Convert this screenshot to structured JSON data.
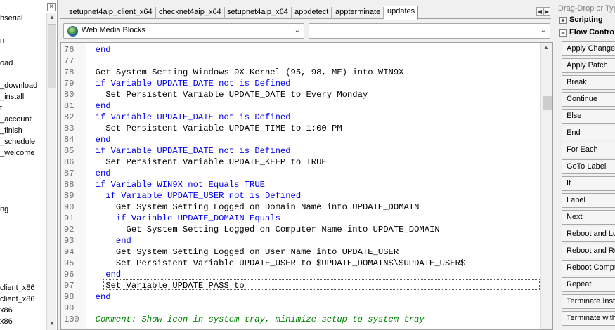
{
  "left_tree": {
    "items": [
      "hserial",
      "n",
      "oad",
      "_download",
      "_install",
      "t",
      "_account",
      "_finish",
      "_schedule",
      "_welcome",
      "ng",
      "client_x86",
      "client_x86",
      "x86",
      "x86"
    ]
  },
  "tabs": [
    "setupnet4aip_client_x64",
    "checknet4aip_x64",
    "setupnet4aip_x64",
    "appdetect",
    "appterminate",
    "updates"
  ],
  "active_tab": "updates",
  "dropdowns": {
    "left_value": "Web Media Blocks",
    "right_value": ""
  },
  "editor": {
    "lines": [
      {
        "num": "76",
        "text": "  end",
        "style": "blue"
      },
      {
        "num": "77",
        "text": "",
        "style": "plain"
      },
      {
        "num": "78",
        "text": "  Get System Setting Windows 9X Kernel (95, 98, ME) into WIN9X",
        "style": "plain"
      },
      {
        "num": "79",
        "text": "  if Variable UPDATE_DATE not is Defined",
        "style": "blue"
      },
      {
        "num": "80",
        "text": "    Set Persistent Variable UPDATE_DATE to Every Monday",
        "style": "plain"
      },
      {
        "num": "81",
        "text": "  end",
        "style": "blue"
      },
      {
        "num": "82",
        "text": "  if Variable UPDATE_DATE not is Defined",
        "style": "blue"
      },
      {
        "num": "83",
        "text": "    Set Persistent Variable UPDATE_TIME to 1:00 PM",
        "style": "plain"
      },
      {
        "num": "84",
        "text": "  end",
        "style": "blue"
      },
      {
        "num": "85",
        "text": "  if Variable UPDATE_DATE not is Defined",
        "style": "blue"
      },
      {
        "num": "86",
        "text": "    Set Persistent Variable UPDATE_KEEP to TRUE",
        "style": "plain"
      },
      {
        "num": "87",
        "text": "  end",
        "style": "blue"
      },
      {
        "num": "88",
        "text": "  if Variable WIN9X not Equals TRUE",
        "style": "blue"
      },
      {
        "num": "89",
        "text": "    if Variable UPDATE_USER not is Defined",
        "style": "blue"
      },
      {
        "num": "90",
        "text": "      Get System Setting Logged on Domain Name into UPDATE_DOMAIN",
        "style": "plain"
      },
      {
        "num": "91",
        "text": "      if Variable UPDATE_DOMAIN Equals",
        "style": "blue"
      },
      {
        "num": "92",
        "text": "        Get System Setting Logged on Computer Name into UPDATE_DOMAIN",
        "style": "plain"
      },
      {
        "num": "93",
        "text": "      end",
        "style": "blue"
      },
      {
        "num": "94",
        "text": "      Get System Setting Logged on User Name into UPDATE_USER",
        "style": "plain"
      },
      {
        "num": "95",
        "text": "      Set Persistent Variable UPDATE_USER to $UPDATE_DOMAIN$\\$UPDATE_USER$",
        "style": "plain"
      },
      {
        "num": "96",
        "text": "    end",
        "style": "blue"
      },
      {
        "num": "97",
        "text": "    Set Variable UPDATE PASS to",
        "style": "plain"
      },
      {
        "num": "98",
        "text": "  end",
        "style": "blue"
      },
      {
        "num": "99",
        "text": "",
        "style": "plain"
      },
      {
        "num": "100",
        "text": "  Comment: Show icon in system tray, minimize setup to system tray",
        "style": "comment"
      }
    ]
  },
  "right_panel": {
    "header": "Drag-Drop or Typ",
    "sections": [
      {
        "box": "+",
        "label": "Scripting"
      },
      {
        "box": "−",
        "label": "Flow Contro"
      }
    ],
    "actions": [
      "Apply Changes",
      "Apply Patch",
      "Break",
      "Continue",
      "Else",
      "End",
      "For Each",
      "GoTo Label",
      "If",
      "Label",
      "Next",
      "Reboot and Lo",
      "Reboot and Re",
      "Reboot Compu",
      "Repeat",
      "Terminate Inst",
      "Terminate with"
    ]
  }
}
